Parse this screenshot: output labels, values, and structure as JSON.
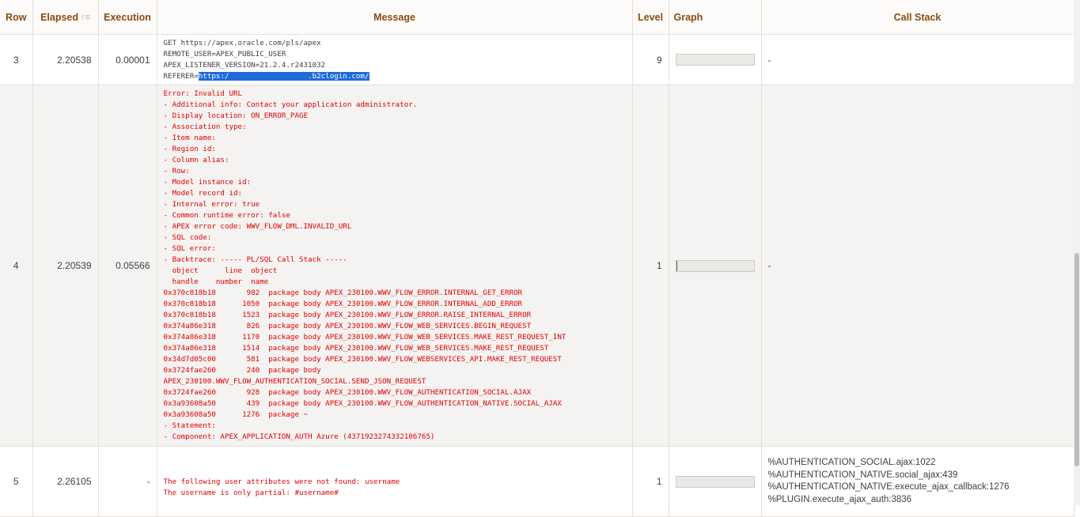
{
  "headers": {
    "row": "Row",
    "elapsed": "Elapsed",
    "elapsed_sort_icon": "↑≡",
    "execution": "Execution",
    "message": "Message",
    "level": "Level",
    "graph": "Graph",
    "call_stack": "Call Stack"
  },
  "rows": [
    {
      "row": "3",
      "elapsed": "2.20538",
      "execution": "0.00001",
      "message_lines": [
        "GET https://apex.oracle.com/pls/apex",
        "REMOTE_USER=APEX_PUBLIC_USER",
        "APEX_LISTENER_VERSION=21.2.4.r2431032"
      ],
      "referer_prefix": "REFERER=",
      "referer_highlight": "https:/                  .b2clogin.com/",
      "level": "9",
      "graph_percent": 0,
      "call_stack": "-"
    },
    {
      "row": "4",
      "elapsed": "2.20539",
      "execution": "0.05566",
      "message": "Error: Invalid URL\n- Additional info: Contact your application administrator.\n- Display location: ON_ERROR_PAGE\n- Association type:\n- Item name:\n- Region id:\n- Column alias:\n- Row:\n- Model instance id:\n- Model record id:\n- Internal error: true\n- Common runtime error: false\n- APEX error code: WWV_FLOW_DML.INVALID_URL\n- SQL code:\n- SQL error:\n- Backtrace: ----- PL/SQL Call Stack -----\n  object      line  object\n  handle    number  name\n0x370c818b18       982  package body APEX_230100.WWV_FLOW_ERROR.INTERNAL_GET_ERROR\n0x370c818b18      1050  package body APEX_230100.WWV_FLOW_ERROR.INTERNAL_ADD_ERROR\n0x370c818b18      1523  package body APEX_230100.WWV_FLOW_ERROR.RAISE_INTERNAL_ERROR\n0x374a86e318       826  package body APEX_230100.WWV_FLOW_WEB_SERVICES.BEGIN_REQUEST\n0x374a86e318      1170  package body APEX_230100.WWV_FLOW_WEB_SERVICES.MAKE_REST_REQUEST_INT\n0x374a86e318      1514  package body APEX_230100.WWV_FLOW_WEB_SERVICES.MAKE_REST_REQUEST\n0x34d7d05c00       581  package body APEX_230100.WWV_FLOW_WEBSERVICES_API.MAKE_REST_REQUEST\n0x3724fae260       240  package body\nAPEX_230100.WWV_FLOW_AUTHENTICATION_SOCIAL.SEND_JSON_REQUEST\n0x3724fae260       928  package body APEX_230100.WWV_FLOW_AUTHENTICATION_SOCIAL.AJAX\n0x3a93608a50       439  package body APEX_230100.WWV_FLOW_AUTHENTICATION_NATIVE.SOCIAL_AJAX\n0x3a93608a50      1276  package ~\n- Statement:\n- Component: APEX_APPLICATION_AUTH Azure (4371923274332106765)",
      "level": "1",
      "graph_percent": 2,
      "call_stack": "-"
    },
    {
      "row": "5",
      "elapsed": "2.26105",
      "execution": "-",
      "message": "The following user attributes were not found: username\nThe username is only partial: #username#",
      "level": "1",
      "graph_percent": 0,
      "call_stack_lines": [
        "%AUTHENTICATION_SOCIAL.ajax:1022",
        "%AUTHENTICATION_NATIVE.social_ajax:439",
        "%AUTHENTICATION_NATIVE.execute_ajax_callback:1276",
        "%PLUGIN.execute_ajax_auth:3836"
      ]
    }
  ],
  "colors": {
    "header_text": "#8a4b0f",
    "error_text": "#e30000",
    "selection": "#1e6bd8",
    "graph_fill": "#2e7d32"
  }
}
